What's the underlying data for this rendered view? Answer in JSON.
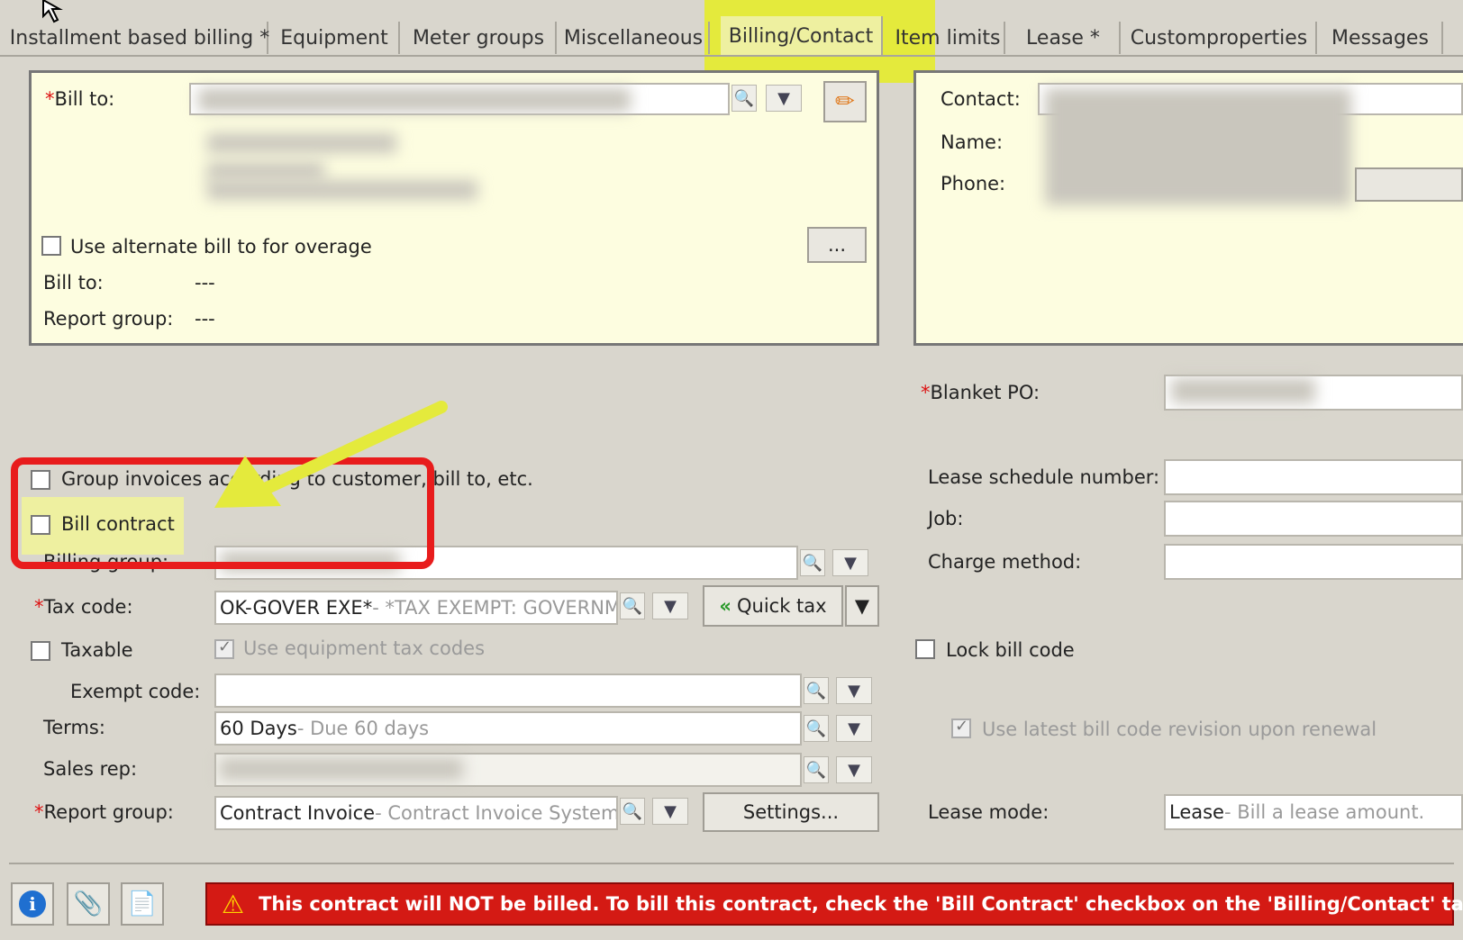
{
  "tabs": [
    {
      "label": "Installment based billing *"
    },
    {
      "label": "Equipment"
    },
    {
      "label": "Meter groups"
    },
    {
      "label": "Miscellaneous"
    },
    {
      "label": "Billing/Contact"
    },
    {
      "label": "Item limits"
    },
    {
      "label": "Lease *"
    },
    {
      "label": "Customproperties"
    },
    {
      "label": "Messages"
    }
  ],
  "bill_panel": {
    "bill_to_label": "Bill to:",
    "alt_bill_label": "Use alternate bill to for overage",
    "alt_bill_btn": "...",
    "bill_to2_label": "Bill to:",
    "bill_to2_value": "---",
    "report_group_label": "Report group:",
    "report_group_value": "---"
  },
  "contact_panel": {
    "contact_label": "Contact:",
    "name_label": "Name:",
    "phone_label": "Phone:"
  },
  "right_form": {
    "blanket_po_label": "Blanket PO:",
    "lease_schedule_label": "Lease schedule number:",
    "job_label": "Job:",
    "charge_method_label": "Charge method:",
    "lock_bill_code_label": "Lock bill code",
    "use_latest_label": "Use latest bill code revision upon renewal",
    "lease_mode_label": "Lease mode:",
    "lease_mode_value": "Lease",
    "lease_mode_desc": " - Bill a lease amount."
  },
  "left_form": {
    "group_invoices_label": "Group invoices according to customer, bill to, etc.",
    "bill_contract_label": "Bill contract",
    "billing_group_label": "Billing group:",
    "tax_code_label": "Tax code:",
    "tax_code_value": "OK-GOVER EXE*",
    "tax_code_desc": " - *TAX EXEMPT: GOVERNME",
    "quick_tax_label": "Quick tax",
    "taxable_label": "Taxable",
    "use_equipment_tax_label": "Use equipment tax codes",
    "exempt_code_label": "Exempt code:",
    "terms_label": "Terms:",
    "terms_value": "60 Days",
    "terms_desc": " - Due 60 days",
    "sales_rep_label": "Sales rep:",
    "report_group_label": "Report group:",
    "report_group_value": "Contract Invoice",
    "report_group_desc": " - Contract Invoice System D",
    "settings_label": "Settings..."
  },
  "banner": {
    "message": "This contract will NOT be billed.  To bill this contract, check the 'Bill Contract' checkbox on the 'Billing/Contact' tab."
  },
  "colors": {
    "annotation_red": "#e81c1c",
    "annotation_yellow": "#e4ea3c",
    "banner_red": "#d41a14"
  },
  "icons": [
    "lookup-icon",
    "dropdown-icon",
    "pencil-icon",
    "info-icon",
    "paperclip-icon",
    "document-icon",
    "warning-icon",
    "double-chevron-left-icon",
    "arrow-icon"
  ]
}
